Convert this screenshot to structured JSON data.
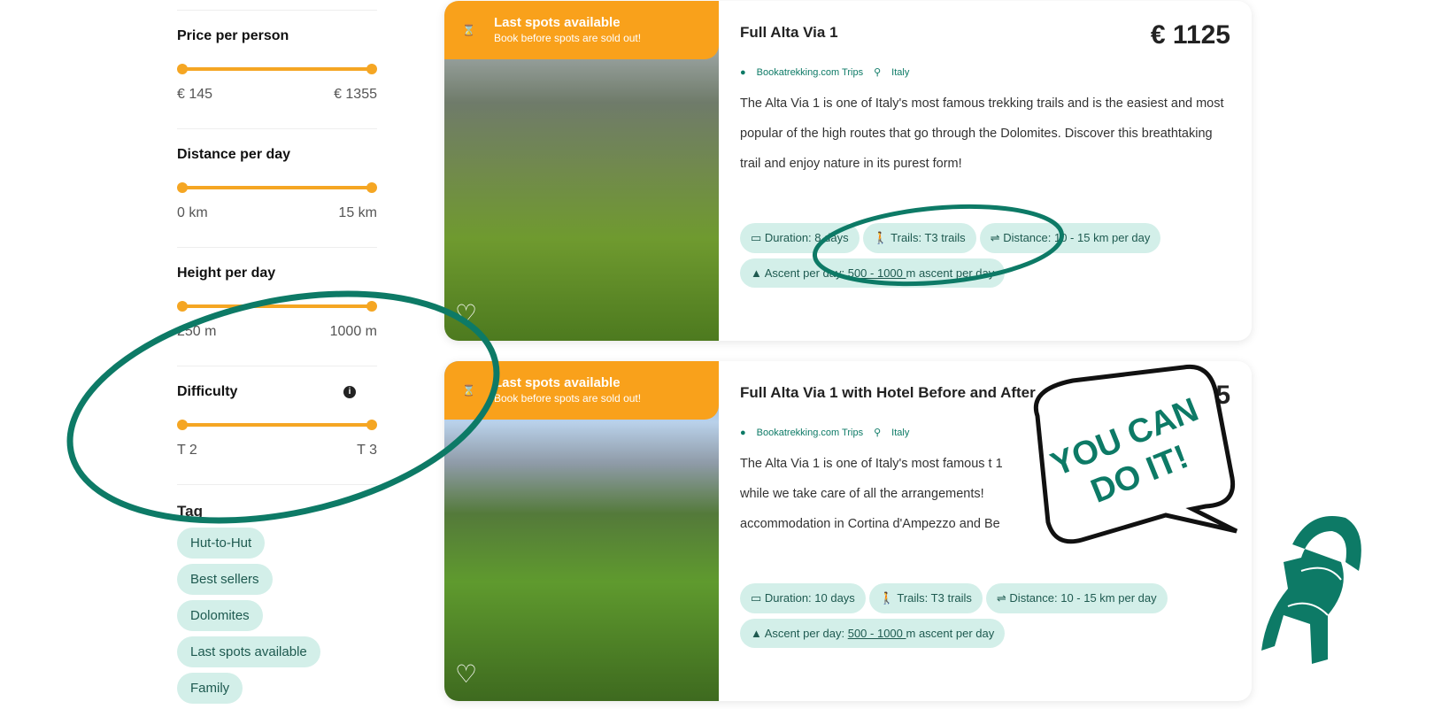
{
  "filters": [
    {
      "title": "Price per person",
      "min": "€ 145",
      "max": "€ 1355"
    },
    {
      "title": "Distance per day",
      "min": "0 km",
      "max": "15 km"
    },
    {
      "title": "Height per day",
      "min": "250 m",
      "max": "1000 m"
    },
    {
      "title": "Difficulty",
      "min": "T 2",
      "max": "T 3",
      "info_icon": "i"
    }
  ],
  "tag_section": {
    "title": "Tag",
    "tags": [
      "Hut-to-Hut",
      "Best sellers",
      "Dolomites",
      "Last spots available",
      "Family"
    ]
  },
  "cards": [
    {
      "badge_title": "Last spots available",
      "badge_sub": "Book before spots are sold out!",
      "title": "Full Alta Via 1",
      "price": "€ 1125",
      "operator": "Bookatrekking.com Trips",
      "country": "Italy",
      "desc": "The Alta Via 1 is one of Italy's most famous trekking trails and is the easiest and most popular of the high routes that go through the Dolomites. Discover this breathtaking trail and enjoy nature in its purest form!",
      "duration": "Duration: 8 days",
      "trails": "Trails: T3 trails",
      "distance": "Distance: 10 - 15 km per day",
      "ascent_pre": "Ascent per day: ",
      "ascent_link": "500 - 1000 ",
      "ascent_post": "m ascent per day"
    },
    {
      "badge_title": "Last spots available",
      "badge_sub": "Book before spots are sold out!",
      "title": "Full Alta Via 1 with Hotel Before and After",
      "price": "5",
      "operator": "Bookatrekking.com Trips",
      "country": "Italy",
      "desc": "The Alta Via 1 is one of Italy's most famous t 1 while we take care of all the arrangements! accommodation in Cortina d'Ampezzo and Be",
      "duration": "Duration: 10 days",
      "trails": "Trails: T3 trails",
      "distance": "Distance: 10 - 15 km per day",
      "ascent_pre": "Ascent per day: ",
      "ascent_link": "500 - 1000 ",
      "ascent_post": "m ascent per day"
    }
  ],
  "bubble": {
    "line1": "YOU CAN",
    "line2": "DO IT!"
  },
  "colors": {
    "accent": "#f9a11b",
    "brand": "#0d7a66",
    "chip": "#d3efe9"
  }
}
